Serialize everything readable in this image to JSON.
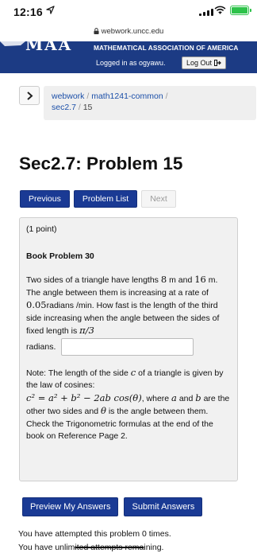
{
  "status_bar": {
    "time": "12:16",
    "icons": [
      "location-icon",
      "signal-icon",
      "wifi-icon",
      "battery-charging-icon"
    ],
    "battery_color": "#2ec24a"
  },
  "browser": {
    "url": "webwork.uncc.edu"
  },
  "banner": {
    "logo_text": "MAA",
    "association": "MATHEMATICAL ASSOCIATION OF AMERICA",
    "logged_in_text": "Logged in as ogyawu.",
    "logout_label": "Log Out",
    "color": "#1c3b84"
  },
  "breadcrumb": {
    "items": [
      "webwork",
      "math1241-common",
      "sec2.7"
    ],
    "current": "15",
    "separator": "/"
  },
  "page_title": "Sec2.7: Problem 15",
  "nav": {
    "previous": "Previous",
    "problem_list": "Problem List",
    "next": "Next"
  },
  "problem": {
    "points": "(1 point)",
    "book_problem": "Book Problem 30",
    "sentence_1a": "Two sides of a triangle have lengths",
    "len1": "8",
    "sentence_1b": "m and",
    "len2": "16",
    "sentence_1c": "m. The angle between them is increasing at a rate of",
    "rate": "0.05",
    "sentence_1d": "radians /min. How fast is the length of the third side increasing when the angle between the sides of fixed length is",
    "angle": "π/3",
    "sentence_1e": "radians.",
    "answer_value": "",
    "note_a": "Note: The length of the side",
    "var_c": "c",
    "note_b": "of a triangle is given by the law of cosines:",
    "formula": "c² = a² + b² − 2ab cos(θ)",
    "note_c": ", where",
    "var_a": "a",
    "note_and": "and",
    "var_b": "b",
    "note_d": "are the other two sides and",
    "var_theta": "θ",
    "note_e": "is the angle between them. Check the Trigonometric formulas at the end of the book on Reference Page 2."
  },
  "actions": {
    "preview": "Preview My Answers",
    "submit": "Submit Answers"
  },
  "attempts": {
    "line1": "You have attempted this problem 0 times.",
    "line2a": "You have unlim",
    "line2b": "ited attempts rema",
    "line2c": "ining."
  }
}
